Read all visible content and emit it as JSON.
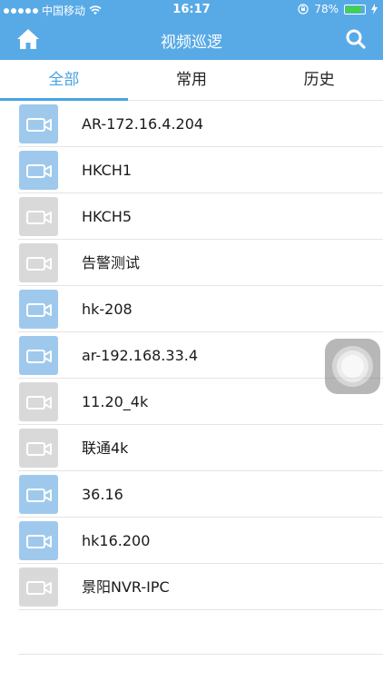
{
  "status_bar": {
    "carrier": "中国移动",
    "time": "16:17",
    "battery_percent": "78%",
    "battery_level": 0.78,
    "battery_color": "#3ed34a"
  },
  "header": {
    "title": "视频巡逻",
    "home_icon": "home-icon",
    "search_icon": "search-icon",
    "bg_color": "#58aae6"
  },
  "tabs": [
    {
      "label": "全部",
      "active": true
    },
    {
      "label": "常用",
      "active": false
    },
    {
      "label": "历史",
      "active": false
    }
  ],
  "accent_color": "#4aa3e3",
  "devices": [
    {
      "name": "AR-172.16.4.204",
      "status": "online"
    },
    {
      "name": "HKCH1",
      "status": "online"
    },
    {
      "name": "HKCH5",
      "status": "offline"
    },
    {
      "name": "告警测试",
      "status": "offline"
    },
    {
      "name": "hk-208",
      "status": "online"
    },
    {
      "name": "ar-192.168.33.4",
      "status": "online"
    },
    {
      "name": "11.20_4k",
      "status": "offline"
    },
    {
      "name": "联通4k",
      "status": "offline"
    },
    {
      "name": "36.16",
      "status": "online"
    },
    {
      "name": "hk16.200",
      "status": "online"
    },
    {
      "name": "景阳NVR-IPC",
      "status": "offline"
    }
  ],
  "status_colors": {
    "online": "#9fc9ec",
    "offline": "#d9d9d9"
  }
}
